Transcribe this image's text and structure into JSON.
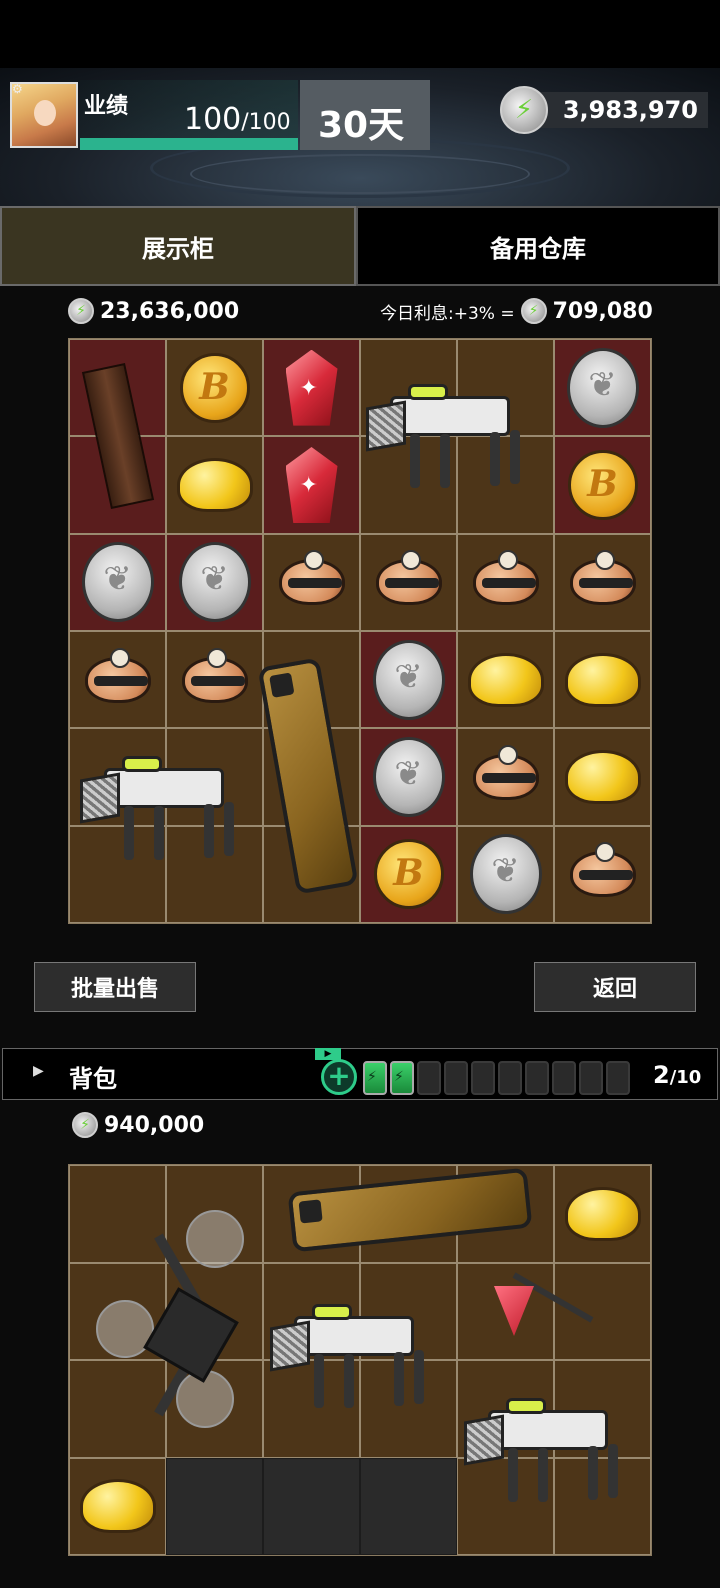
{
  "header": {
    "label": "业绩",
    "hp_current": "100",
    "hp_max": "/100",
    "hp_fraction": 1.0,
    "days": "30天",
    "money": "3,983,970"
  },
  "tabs": {
    "active": "展示柜",
    "inactive": "备用仓库"
  },
  "showcase": {
    "total_value": "23,636,000",
    "interest_label": "今日利息:+3% =",
    "interest_value": "709,080"
  },
  "buttons": {
    "sell": "批量出售",
    "back": "返回"
  },
  "bag": {
    "title": "背包",
    "count_current": "2",
    "count_max": "/10",
    "batteries_filled": 2,
    "batteries_total": 10,
    "value": "940,000"
  },
  "colors": {
    "accent_green": "#2bb38e",
    "cell_brown": "#4d3518",
    "cell_red": "#5a1d1d"
  }
}
